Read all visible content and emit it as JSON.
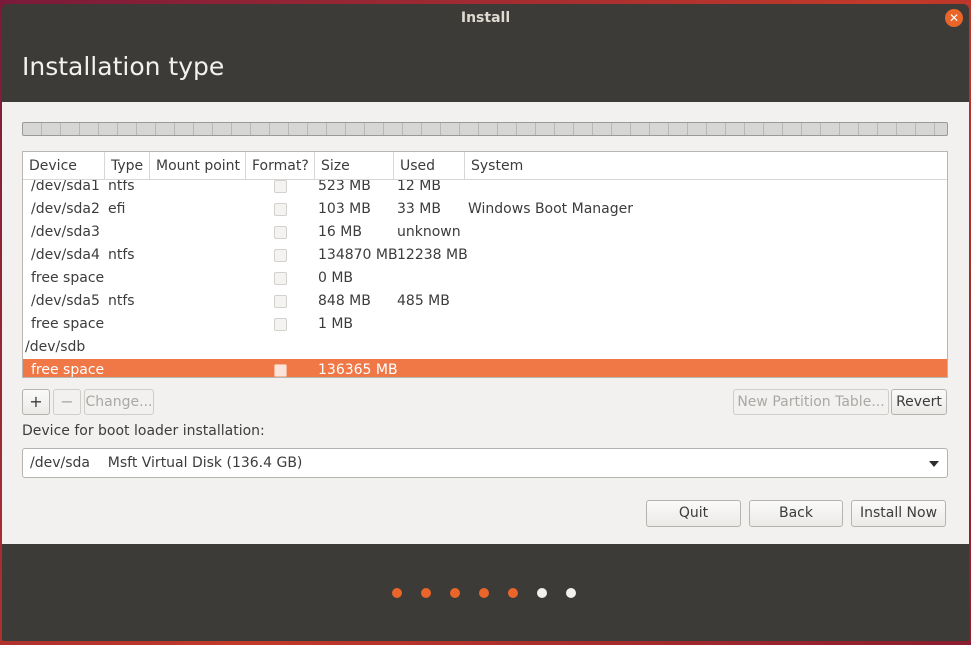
{
  "window": {
    "title": "Install"
  },
  "header": {
    "title": "Installation type"
  },
  "table": {
    "columns": [
      "Device",
      "Type",
      "Mount point",
      "Format?",
      "Size",
      "Used",
      "System"
    ],
    "rows": [
      {
        "device": "/dev/sda1",
        "type": "ntfs",
        "mount": "",
        "format": false,
        "size": "523 MB",
        "used": "12 MB",
        "system": ""
      },
      {
        "device": "/dev/sda2",
        "type": "efi",
        "mount": "",
        "format": false,
        "size": "103 MB",
        "used": "33 MB",
        "system": "Windows Boot Manager"
      },
      {
        "device": "/dev/sda3",
        "type": "",
        "mount": "",
        "format": false,
        "size": "16 MB",
        "used": "unknown",
        "system": ""
      },
      {
        "device": "/dev/sda4",
        "type": "ntfs",
        "mount": "",
        "format": false,
        "size": "134870 MB",
        "used": "12238 MB",
        "system": ""
      },
      {
        "device": "free space",
        "type": "",
        "mount": "",
        "format": false,
        "size": "0 MB",
        "used": "",
        "system": ""
      },
      {
        "device": "/dev/sda5",
        "type": "ntfs",
        "mount": "",
        "format": false,
        "size": "848 MB",
        "used": "485 MB",
        "system": ""
      },
      {
        "device": "free space",
        "type": "",
        "mount": "",
        "format": false,
        "size": "1 MB",
        "used": "",
        "system": ""
      },
      {
        "device": "/dev/sdb",
        "type": "",
        "mount": "",
        "format": null,
        "size": "",
        "used": "",
        "system": ""
      },
      {
        "device": "free space",
        "type": "",
        "mount": "",
        "format": false,
        "size": "136365 MB",
        "used": "",
        "system": "",
        "selected": true
      }
    ]
  },
  "partition_buttons": {
    "add": "+",
    "remove": "−",
    "change": "Change...",
    "new_table": "New Partition Table...",
    "revert": "Revert"
  },
  "bootloader": {
    "label": "Device for boot loader installation:",
    "selected": "/dev/sda    Msft Virtual Disk (136.4 GB)"
  },
  "nav_buttons": {
    "quit": "Quit",
    "back": "Back",
    "install_now": "Install Now"
  },
  "progress": {
    "total_steps": 7,
    "completed_steps": 5,
    "active_color": "#e9652a",
    "inactive_color": "#f2f1f0"
  }
}
